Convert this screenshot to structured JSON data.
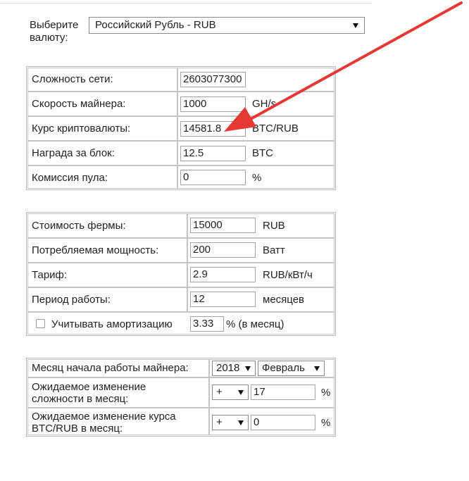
{
  "currency": {
    "label": "Выберите валюту:",
    "selected": "Российский Рубль - RUB"
  },
  "network": {
    "rows": [
      {
        "label": "Сложность сети:",
        "value": "2603077300",
        "unit": ""
      },
      {
        "label": "Скорость майнера:",
        "value": "1000",
        "unit": "GH/s"
      },
      {
        "label": "Курс криптовалюты:",
        "value": "14581.8",
        "unit": "BTC/RUB"
      },
      {
        "label": "Награда за блок:",
        "value": "12.5",
        "unit": "BTC"
      },
      {
        "label": "Комиссия пула:",
        "value": "0",
        "unit": "%"
      }
    ]
  },
  "farm": {
    "rows": [
      {
        "label": "Стоимость фермы:",
        "value": "15000",
        "unit": "RUB"
      },
      {
        "label": "Потребляемая мощность:",
        "value": "200",
        "unit": "Ватт"
      },
      {
        "label": "Тариф:",
        "value": "2.9",
        "unit": "RUB/кВт/ч"
      },
      {
        "label": "Период работы:",
        "value": "12",
        "unit": "месяцев"
      }
    ],
    "amortization": {
      "label": "Учитывать амортизацию",
      "checked": false,
      "value": "3.33",
      "unit": "% (в месяц)"
    }
  },
  "forecast": {
    "start_month": {
      "label": "Месяц начала работы майнера:",
      "year": "2018",
      "month": "Февраль"
    },
    "difficulty_change": {
      "label_line1": "Ожидаемое изменение",
      "label_line2": "сложности в месяц:",
      "sign": "+",
      "value": "17",
      "unit": "%"
    },
    "rate_change": {
      "label_line1": "Ожидаемое изменение курса",
      "label_line2": "BTC/RUB в месяц:",
      "sign": "+",
      "value": "0",
      "unit": "%"
    }
  },
  "colors": {
    "arrow": "#e53935",
    "border": "#b9b9b9"
  },
  "icons": [
    "chevron-down-icon",
    "checkbox-icon",
    "red-arrow-annotation"
  ]
}
